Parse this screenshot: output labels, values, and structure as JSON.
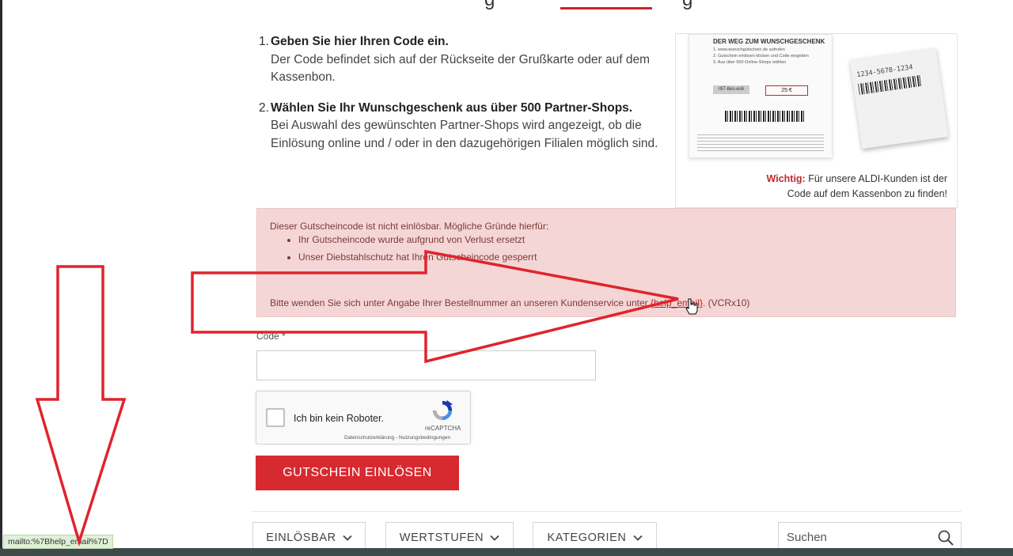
{
  "header": {
    "title_fragment_left": "g",
    "title_fragment_right": "g"
  },
  "steps": [
    {
      "number": "1.",
      "heading": "Geben Sie hier Ihren Code ein.",
      "body": "Der Code befindet sich auf der Rückseite der Grußkarte oder auf dem Kassenbon."
    },
    {
      "number": "2.",
      "heading": "Wählen Sie Ihr Wunschgeschenk aus über 500 Partner-Shops.",
      "body": "Bei Auswahl des gewünschten Partner-Shops wird angezeigt, ob die Einlösung online und / oder in den dazugehörigen Filialen möglich sind."
    }
  ],
  "info_card": {
    "image_title": "DER WEG ZUM WUNSCHGESCHENK",
    "image_line1": "1. www.wunschgutschein.de aufrufen",
    "image_line2": "2. Gutschein einlösen klicken und Code eingeben",
    "image_line3": "3. Aus über 500 Online-Shops wählen",
    "image_code": "r87-8es-es6",
    "image_value": "25 €",
    "receipt_code": "1234-5678-1234",
    "note_emphasis": "Wichtig:",
    "note_line1": "Für unsere ALDI-Kunden ist der",
    "note_line2": "Code auf dem Kassenbon zu finden!"
  },
  "error": {
    "heading": "Dieser Gutscheincode ist nicht einlösbar. Mögliche Gründe hierfür:",
    "reasons": [
      "Ihr Gutscheincode wurde aufgrund von Verlust ersetzt",
      "Unser Diebstahlschutz hat Ihren Gutscheincode gesperrt"
    ],
    "footer_prefix": "Bitte wenden Sie sich unter Angabe Ihrer Bestellnummer an unseren Kundenservice unter ",
    "footer_link": "{help_email}",
    "footer_suffix": ". (VCRx10)"
  },
  "form": {
    "code_label": "Code *",
    "code_value": "",
    "recaptcha_label": "Ich bin kein Roboter.",
    "recaptcha_brand": "reCAPTCHA",
    "recaptcha_links": "Datenschutzerklärung - Nutzungsbedingungen",
    "submit_label": "GUTSCHEIN EINLÖSEN"
  },
  "filters": {
    "items": [
      {
        "label": "EINLÖSBAR"
      },
      {
        "label": "WERTSTUFEN"
      },
      {
        "label": "KATEGORIEN"
      }
    ],
    "search_placeholder": "Suchen"
  },
  "status_bar": {
    "url": "mailto:%7Bhelp_email%7D"
  },
  "colors": {
    "accent_red": "#d72a30",
    "error_bg": "#f5d6d6",
    "annotation_red": "#e0242c"
  },
  "icons": [
    "chevron-down-icon",
    "search-icon",
    "recaptcha-icon",
    "pointer-hand-icon",
    "annotation-arrow"
  ]
}
